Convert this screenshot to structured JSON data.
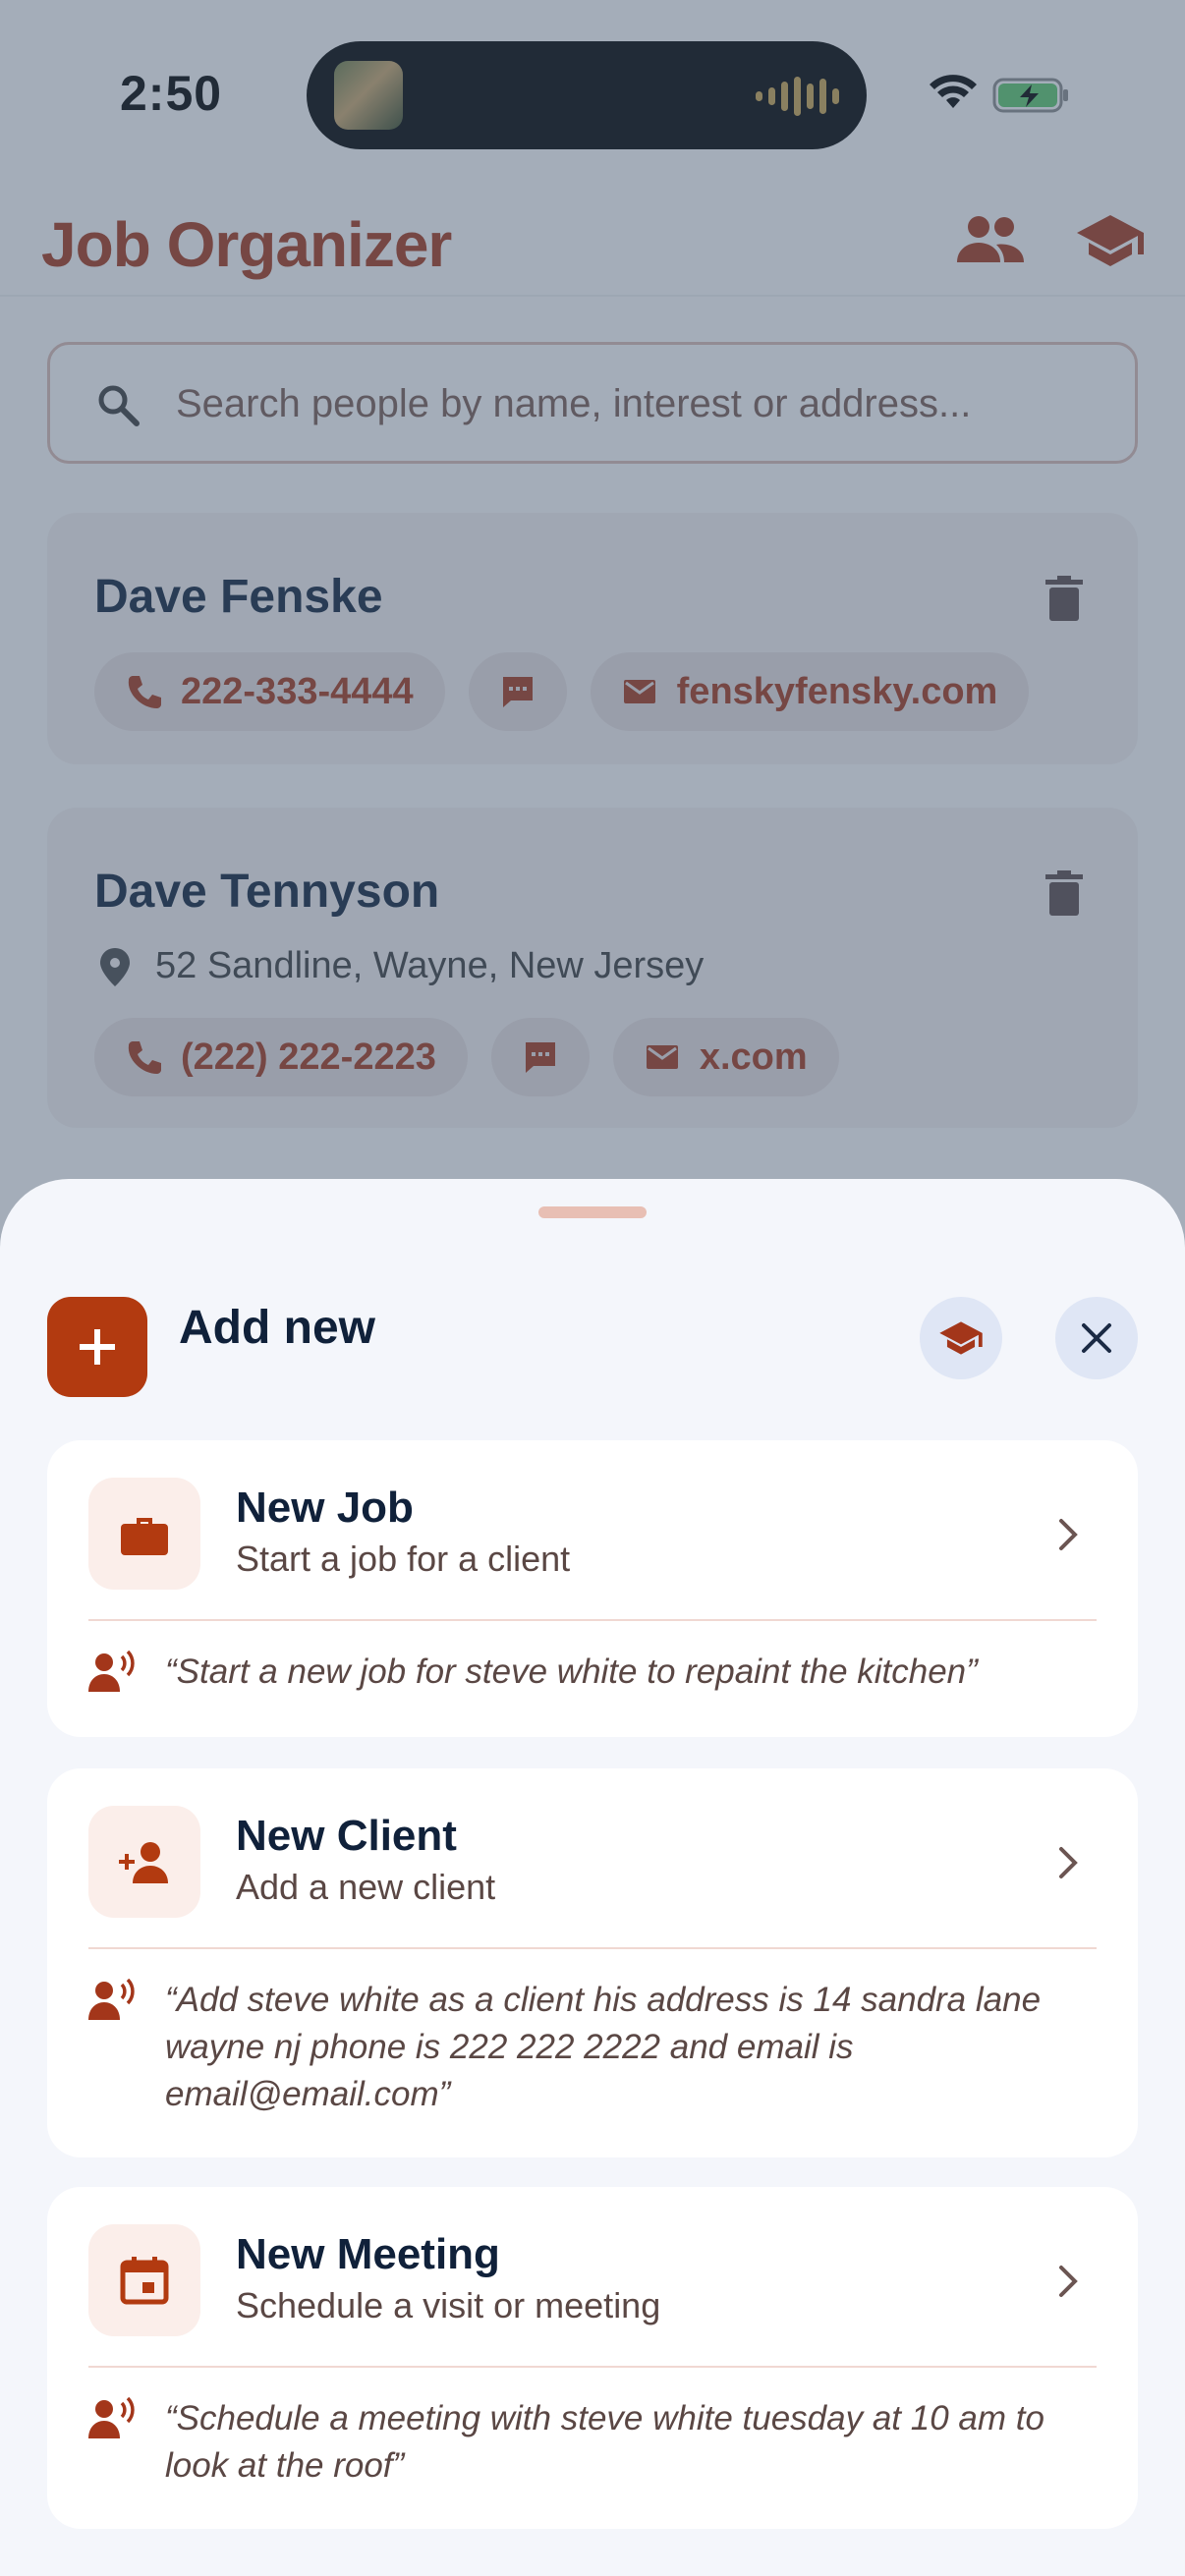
{
  "status": {
    "time": "2:50"
  },
  "app": {
    "title": "Job Organizer"
  },
  "search": {
    "placeholder": "Search people by name, interest or address..."
  },
  "contacts": [
    {
      "name": "Dave Fenske",
      "phone": "222-333-4444",
      "email": "fenskyfensky.com"
    },
    {
      "name": "Dave Tennyson",
      "address": "52 Sandline, Wayne, New Jersey",
      "phone": "(222) 222-2223",
      "email": "x.com"
    }
  ],
  "sheet": {
    "title": "Add new",
    "options": [
      {
        "title": "New Job",
        "subtitle": "Start a job for a client",
        "example": "“Start a new job for steve white to repaint the kitchen”"
      },
      {
        "title": "New Client",
        "subtitle": "Add a new client",
        "example": "“Add steve white as a client his address is 14 sandra lane wayne nj phone is 222 222 2222 and email is email@email.com”"
      },
      {
        "title": "New Meeting",
        "subtitle": "Schedule a visit or meeting",
        "example": "“Schedule a meeting with steve white tuesday at 10 am to look at the roof”"
      }
    ]
  },
  "colors": {
    "accent": "#a3361a",
    "accent_button": "#b23a10",
    "scrim": "#465a73",
    "sheet_bg": "#f4f6fb"
  },
  "icons": [
    "people-icon",
    "school-icon",
    "search-icon",
    "trash-icon",
    "phone-icon",
    "message-icon",
    "mail-icon",
    "location-icon",
    "plus-icon",
    "close-icon",
    "briefcase-icon",
    "person-add-icon",
    "calendar-icon",
    "chevron-right-icon",
    "voice-icon"
  ]
}
